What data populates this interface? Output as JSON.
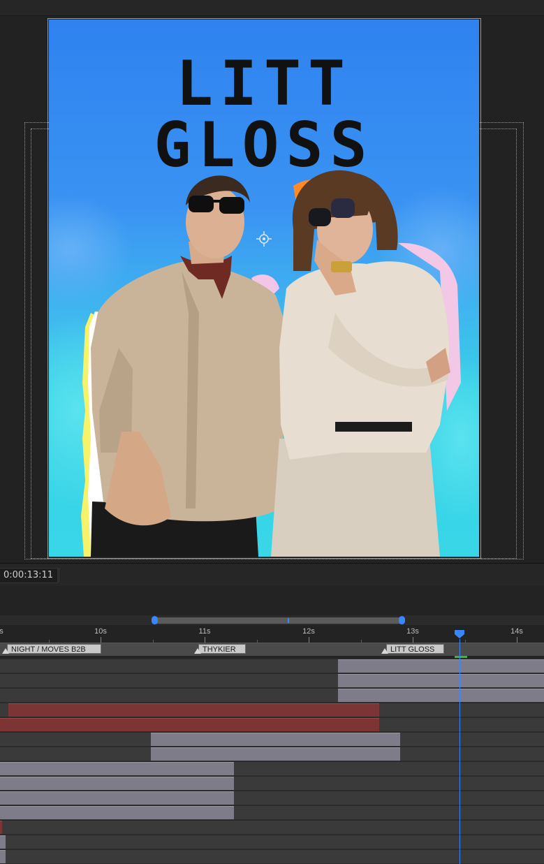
{
  "viewer": {
    "poster_title": "LITT GLOSS"
  },
  "timeline": {
    "current_time": "0:00:13:11",
    "ruler_labels": [
      "s",
      "10s",
      "11s",
      "12s",
      "13s",
      "14s"
    ],
    "markers": [
      {
        "label": "NIGHT / MOVES B2B"
      },
      {
        "label": "THYKIER"
      },
      {
        "label": "LITT GLOSS"
      }
    ]
  },
  "colors": {
    "accent": "#3a86ff",
    "clip_default": "#7d7c88",
    "clip_red": "#7c3434",
    "work_area_end": "#2ec02e"
  },
  "icons": {
    "anchor": "anchor-point-icon",
    "playhead": "playhead-icon",
    "marker": "marker-icon"
  }
}
